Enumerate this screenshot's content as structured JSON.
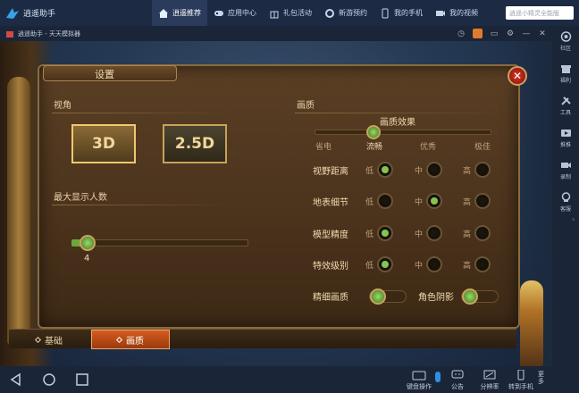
{
  "topbar": {
    "brand": "逍遥助手",
    "nav": [
      {
        "label": "逍遥推荐",
        "icon": "home-icon",
        "active": true
      },
      {
        "label": "应用中心",
        "icon": "gamepad-icon",
        "active": false
      },
      {
        "label": "礼包活动",
        "icon": "gift-icon",
        "active": false
      },
      {
        "label": "新游预约",
        "icon": "gear-icon",
        "active": false
      },
      {
        "label": "我的手机",
        "icon": "phone-icon",
        "active": false
      },
      {
        "label": "我的视频",
        "icon": "video-icon",
        "active": false
      }
    ],
    "search_placeholder": "逍遥小精灵全能版"
  },
  "titlebar": {
    "title": "逍遥助手 - 天天模拟器"
  },
  "rightbar": {
    "items": [
      {
        "label": "社区",
        "icon": "community-icon"
      },
      {
        "label": "福利",
        "icon": "gift-icon"
      },
      {
        "label": "工具",
        "icon": "tools-icon"
      },
      {
        "label": "推推",
        "icon": "push-icon"
      },
      {
        "label": "录制",
        "icon": "camera-icon"
      },
      {
        "label": "客服",
        "icon": "support-icon"
      }
    ]
  },
  "settings": {
    "title": "设置",
    "view": {
      "label": "视角",
      "options": [
        "3D",
        "2.5D"
      ],
      "selected": "3D"
    },
    "max_players": {
      "label": "最大显示人数",
      "value": "4",
      "fraction": 0.09
    },
    "quality": {
      "label": "画质",
      "effect_label": "画质效果",
      "levels": [
        "省电",
        "流畅",
        "优秀",
        "极佳"
      ],
      "selected_level": "流畅",
      "rows": [
        {
          "label": "视野距离",
          "options": [
            "低",
            "中",
            "高"
          ],
          "selected": "低"
        },
        {
          "label": "地表细节",
          "options": [
            "低",
            "中",
            "高"
          ],
          "selected": "中"
        },
        {
          "label": "模型精度",
          "options": [
            "低",
            "中",
            "高"
          ],
          "selected": "低"
        },
        {
          "label": "特效级别",
          "options": [
            "低",
            "中",
            "高"
          ],
          "selected": "低"
        }
      ],
      "toggles": [
        {
          "label": "精细画质",
          "on": true
        },
        {
          "label": "角色阴影",
          "on": true
        }
      ]
    },
    "tabs": [
      {
        "label": "基础",
        "active": false
      },
      {
        "label": "画质",
        "active": true
      }
    ]
  },
  "bottombar": {
    "items": [
      {
        "label": "键盘操作",
        "icon": "keyboard-icon"
      },
      {
        "label": "公告",
        "icon": "chat-icon"
      },
      {
        "label": "分辨率",
        "icon": "resolution-icon"
      },
      {
        "label": "转到手机",
        "icon": "phone-icon"
      }
    ],
    "more": "更多"
  },
  "colors": {
    "accent": "#d65c1f",
    "green": "#86c451",
    "gold": "#c9a25a"
  }
}
